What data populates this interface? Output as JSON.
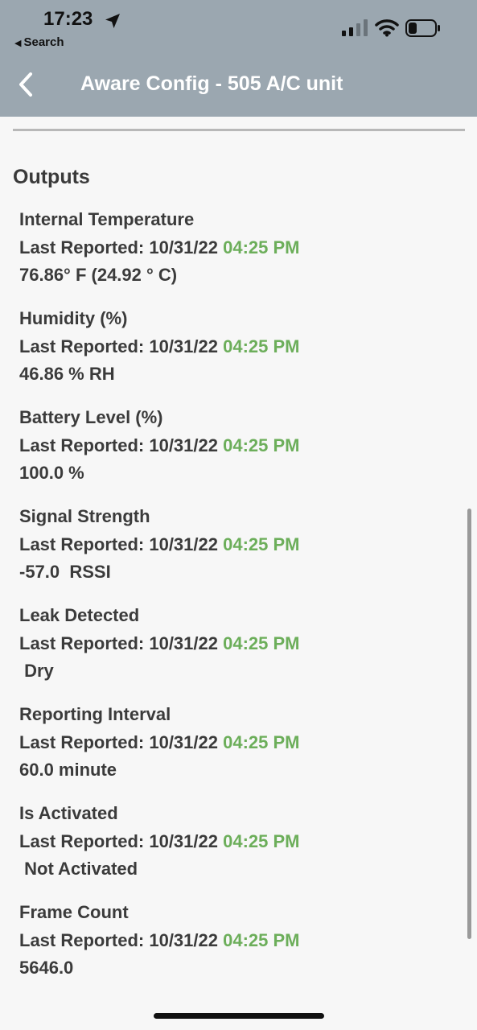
{
  "status_bar": {
    "time": "17:23",
    "back_app": "Search",
    "icons": [
      "location-arrow-icon",
      "cellular-signal-icon",
      "wifi-icon",
      "battery-icon"
    ]
  },
  "nav": {
    "title": "Aware Config - 505 A/C unit",
    "back_icon": "chevron-left-icon"
  },
  "section_title": "Outputs",
  "colors": {
    "header_bg": "#9ba7b0",
    "page_bg": "#f7f7f7",
    "text": "#3b3b3b",
    "time_green": "#6cae5a"
  },
  "outputs": [
    {
      "name": "Internal Temperature",
      "reported_prefix": "Last Reported: 10/31/22",
      "time": "04:25 PM",
      "value": "76.86° F (24.92 ° C)"
    },
    {
      "name": "Humidity (%)",
      "reported_prefix": "Last Reported: 10/31/22",
      "time": "04:25 PM",
      "value": "46.86 % RH"
    },
    {
      "name": "Battery Level (%)",
      "reported_prefix": "Last Reported: 10/31/22",
      "time": "04:25 PM",
      "value": "100.0 %"
    },
    {
      "name": "Signal Strength",
      "reported_prefix": "Last Reported: 10/31/22",
      "time": "04:25 PM",
      "value": "-57.0  RSSI"
    },
    {
      "name": "Leak Detected",
      "reported_prefix": "Last Reported: 10/31/22",
      "time": "04:25 PM",
      "value": " Dry"
    },
    {
      "name": "Reporting Interval",
      "reported_prefix": "Last Reported: 10/31/22",
      "time": "04:25 PM",
      "value": "60.0 minute"
    },
    {
      "name": "Is Activated",
      "reported_prefix": "Last Reported: 10/31/22",
      "time": "04:25 PM",
      "value": " Not Activated"
    },
    {
      "name": "Frame Count",
      "reported_prefix": "Last Reported: 10/31/22",
      "time": "04:25 PM",
      "value": "5646.0"
    }
  ]
}
